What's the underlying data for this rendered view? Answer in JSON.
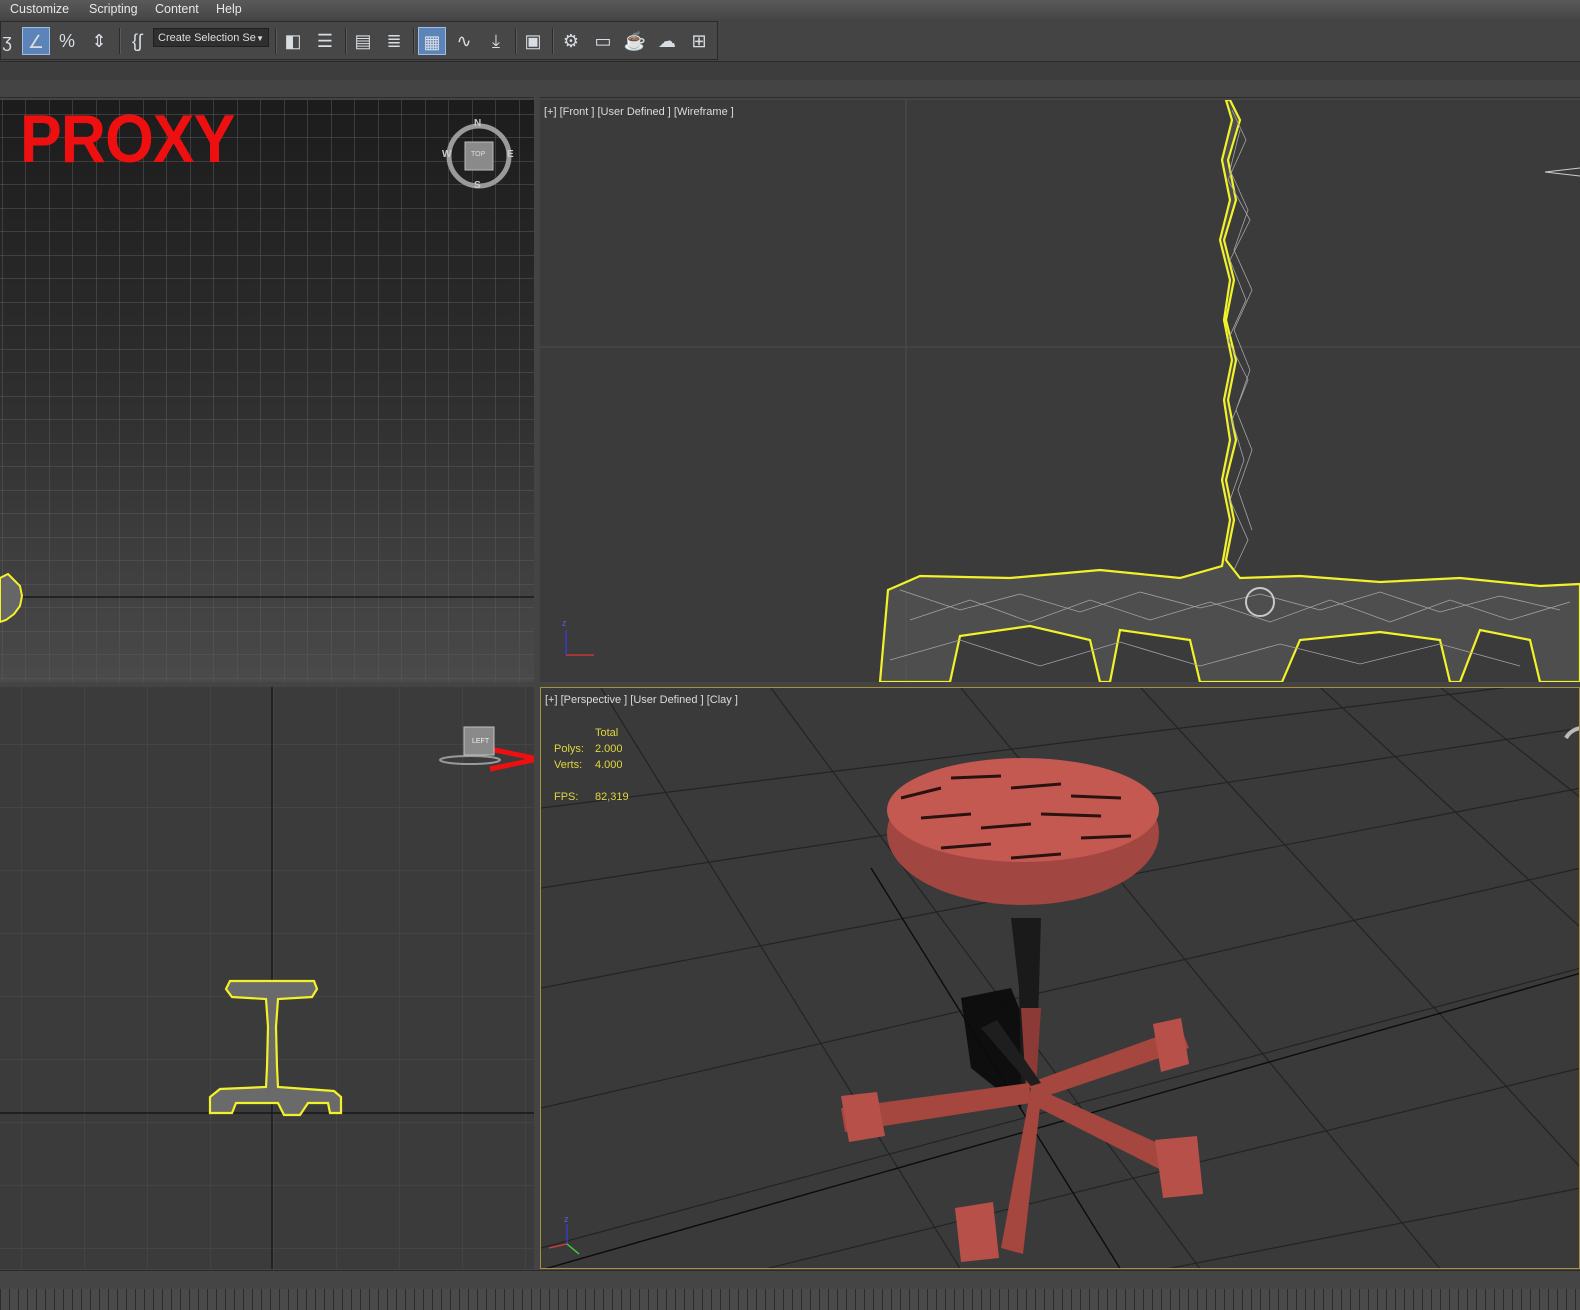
{
  "menu": {
    "items": [
      "Customize",
      "Scripting",
      "Content",
      "Help"
    ]
  },
  "toolbar": {
    "selection_set_value": "Create Selection Se"
  },
  "viewports": {
    "top_left": {
      "overlay_text": "PROXY",
      "viewcube": {
        "face": "TOP",
        "compass": [
          "N",
          "S",
          "W",
          "E"
        ]
      }
    },
    "top_right": {
      "label": "[+] [Front ] [User Defined ] [Wireframe ]",
      "axis_labels": [
        "z"
      ]
    },
    "bottom_left": {
      "viewcube_face": "LEFT"
    },
    "bottom_right": {
      "label": "[+] [Perspective ] [User Defined ] [Clay ]",
      "stats": {
        "header": "Total",
        "polys_label": "Polys:",
        "polys_value": "2.000",
        "verts_label": "Verts:",
        "verts_value": "4.000",
        "fps_label": "FPS:",
        "fps_value": "82,319"
      },
      "axis_labels": [
        "z"
      ]
    }
  },
  "colors": {
    "selection_outline": "#f2f22a",
    "proxy_text": "#ee1010",
    "active_viewport_border": "#a8913a",
    "stool_clay": "#b8504a",
    "stats_text": "#e0d640"
  },
  "icons": [
    "snap-toggle-icon",
    "angle-snap-icon",
    "percent-snap-icon",
    "spinner-snap-icon",
    "edit-named-selection-icon",
    "mirror-icon",
    "align-icon",
    "scene-explorer-icon",
    "layer-explorer-icon",
    "ribbon-toggle-icon",
    "curve-editor-icon",
    "schematic-view-icon",
    "material-editor-icon",
    "render-setup-icon",
    "rendered-frame-window-icon",
    "render-icon",
    "render-iterative-icon",
    "viewport-layout-icon"
  ]
}
